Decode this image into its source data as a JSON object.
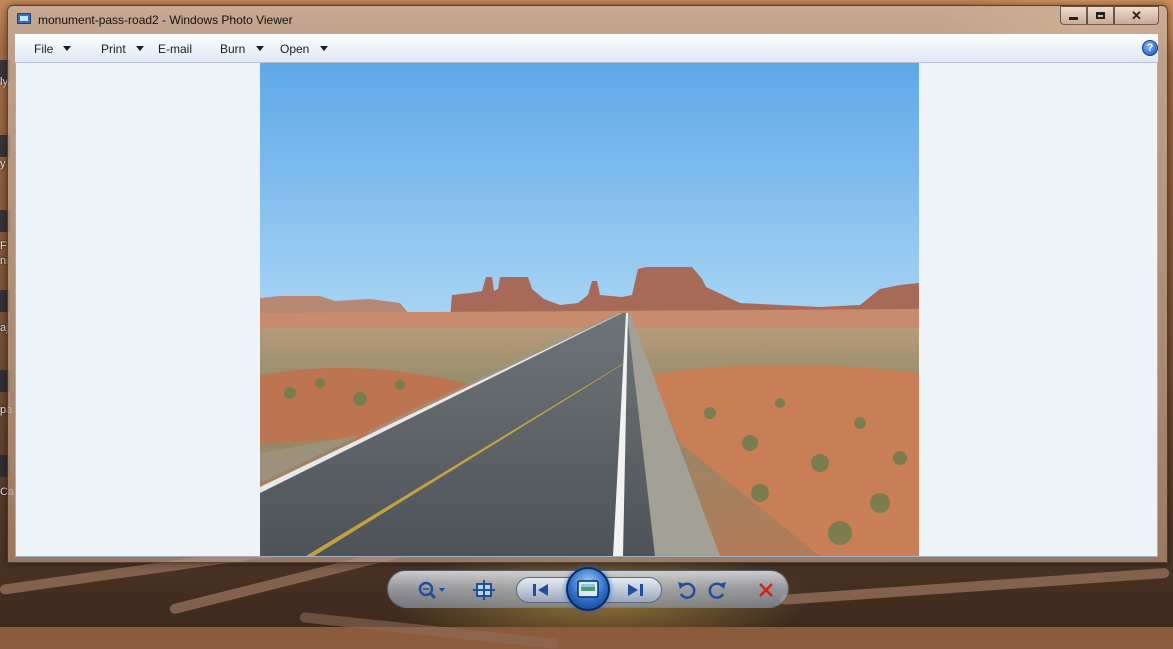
{
  "window": {
    "title": "monument-pass-road2 - Windows Photo Viewer",
    "minimize_icon": "minimize-icon",
    "maximize_icon": "maximize-icon",
    "close_label": "✕"
  },
  "menu": {
    "items": [
      {
        "label": "File",
        "has_dropdown": true
      },
      {
        "label": "Print",
        "has_dropdown": true
      },
      {
        "label": "E-mail",
        "has_dropdown": false
      },
      {
        "label": "Burn",
        "has_dropdown": true
      },
      {
        "label": "Open",
        "has_dropdown": true
      }
    ],
    "help_label": "?"
  },
  "desktop": {
    "left_edge_text": [
      "ly",
      "y",
      "F",
      "ni",
      "aj",
      "pa",
      "Ca"
    ]
  },
  "toolbar": {
    "buttons": [
      {
        "name": "zoom-button",
        "icon": "magnifier-icon"
      },
      {
        "name": "actual-size-button",
        "icon": "fit-window-icon"
      },
      {
        "name": "previous-button",
        "icon": "previous-icon"
      },
      {
        "name": "slideshow-button",
        "icon": "slideshow-icon"
      },
      {
        "name": "next-button",
        "icon": "next-icon"
      },
      {
        "name": "rotate-counterclockwise-button",
        "icon": "rotate-ccw-icon"
      },
      {
        "name": "rotate-clockwise-button",
        "icon": "rotate-cw-icon"
      },
      {
        "name": "delete-button",
        "icon": "delete-icon"
      }
    ]
  },
  "colors": {
    "accent": "#2d6cc4",
    "delete": "#d42020",
    "sky": "#74b5ec"
  }
}
